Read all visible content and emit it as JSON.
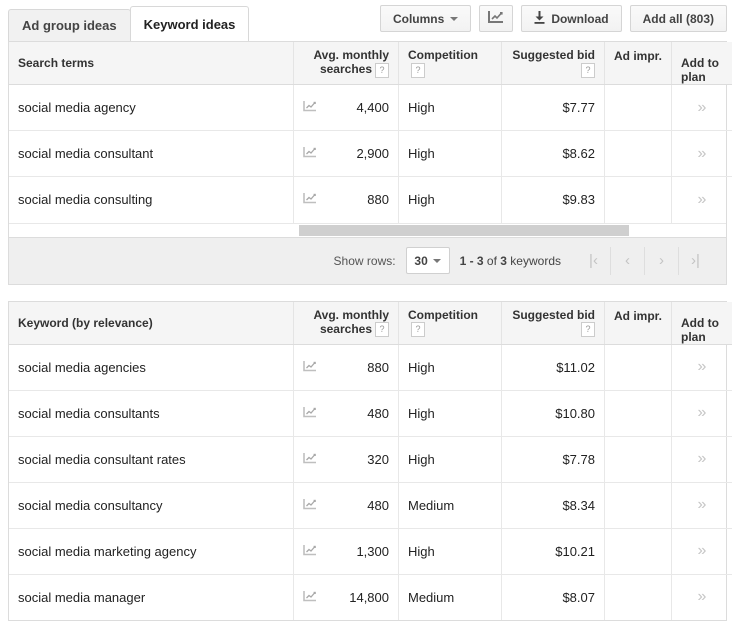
{
  "tabs": [
    {
      "label": "Ad group ideas",
      "active": false
    },
    {
      "label": "Keyword ideas",
      "active": true
    }
  ],
  "toolbar": {
    "columns_label": "Columns",
    "chart_icon": "line-chart-icon",
    "download_label": "Download",
    "download_icon": "download-icon",
    "add_all_label": "Add all (803)"
  },
  "columns": {
    "avg_searches_l1": "Avg. monthly",
    "avg_searches_l2": "searches",
    "competition": "Competition",
    "suggested_bid_l1": "Suggested bid",
    "ad_impr": "Ad impr.",
    "add_to_plan": "Add to plan",
    "help_glyph": "?",
    "chevron_glyph": "»"
  },
  "table1": {
    "header_term": "Search terms",
    "rows": [
      {
        "term": "social media agency",
        "searches": "4,400",
        "competition": "High",
        "bid": "$7.77",
        "ad_impr": "",
        "plan": "»"
      },
      {
        "term": "social media consultant",
        "searches": "2,900",
        "competition": "High",
        "bid": "$8.62",
        "ad_impr": "",
        "plan": "»"
      },
      {
        "term": "social media consulting",
        "searches": "880",
        "competition": "High",
        "bid": "$9.83",
        "ad_impr": "",
        "plan": "»"
      }
    ]
  },
  "pager": {
    "show_rows_label": "Show rows:",
    "rows_value": "30",
    "range_prefix": "1 - 3",
    "range_mid": " of ",
    "range_count": "3",
    "range_suffix": " keywords",
    "first_icon": "|‹",
    "prev_icon": "‹",
    "next_icon": "›",
    "last_icon": "›|"
  },
  "table2": {
    "header_term": "Keyword (by relevance)",
    "rows": [
      {
        "term": "social media agencies",
        "searches": "880",
        "competition": "High",
        "bid": "$11.02",
        "ad_impr": "",
        "plan": "»"
      },
      {
        "term": "social media consultants",
        "searches": "480",
        "competition": "High",
        "bid": "$10.80",
        "ad_impr": "",
        "plan": "»"
      },
      {
        "term": "social media consultant rates",
        "searches": "320",
        "competition": "High",
        "bid": "$7.78",
        "ad_impr": "",
        "plan": "»"
      },
      {
        "term": "social media consultancy",
        "searches": "480",
        "competition": "Medium",
        "bid": "$8.34",
        "ad_impr": "",
        "plan": "»"
      },
      {
        "term": "social media marketing agency",
        "searches": "1,300",
        "competition": "High",
        "bid": "$10.21",
        "ad_impr": "",
        "plan": "»"
      },
      {
        "term": "social media manager",
        "searches": "14,800",
        "competition": "Medium",
        "bid": "$8.07",
        "ad_impr": "",
        "plan": "»"
      }
    ]
  },
  "colors": {
    "page_bg": "#ffffff",
    "header_bg": "#f5f5f5",
    "pager_bg": "#efefef",
    "border": "#dcdcdc",
    "scroll_thumb": "#cfcfcf"
  }
}
